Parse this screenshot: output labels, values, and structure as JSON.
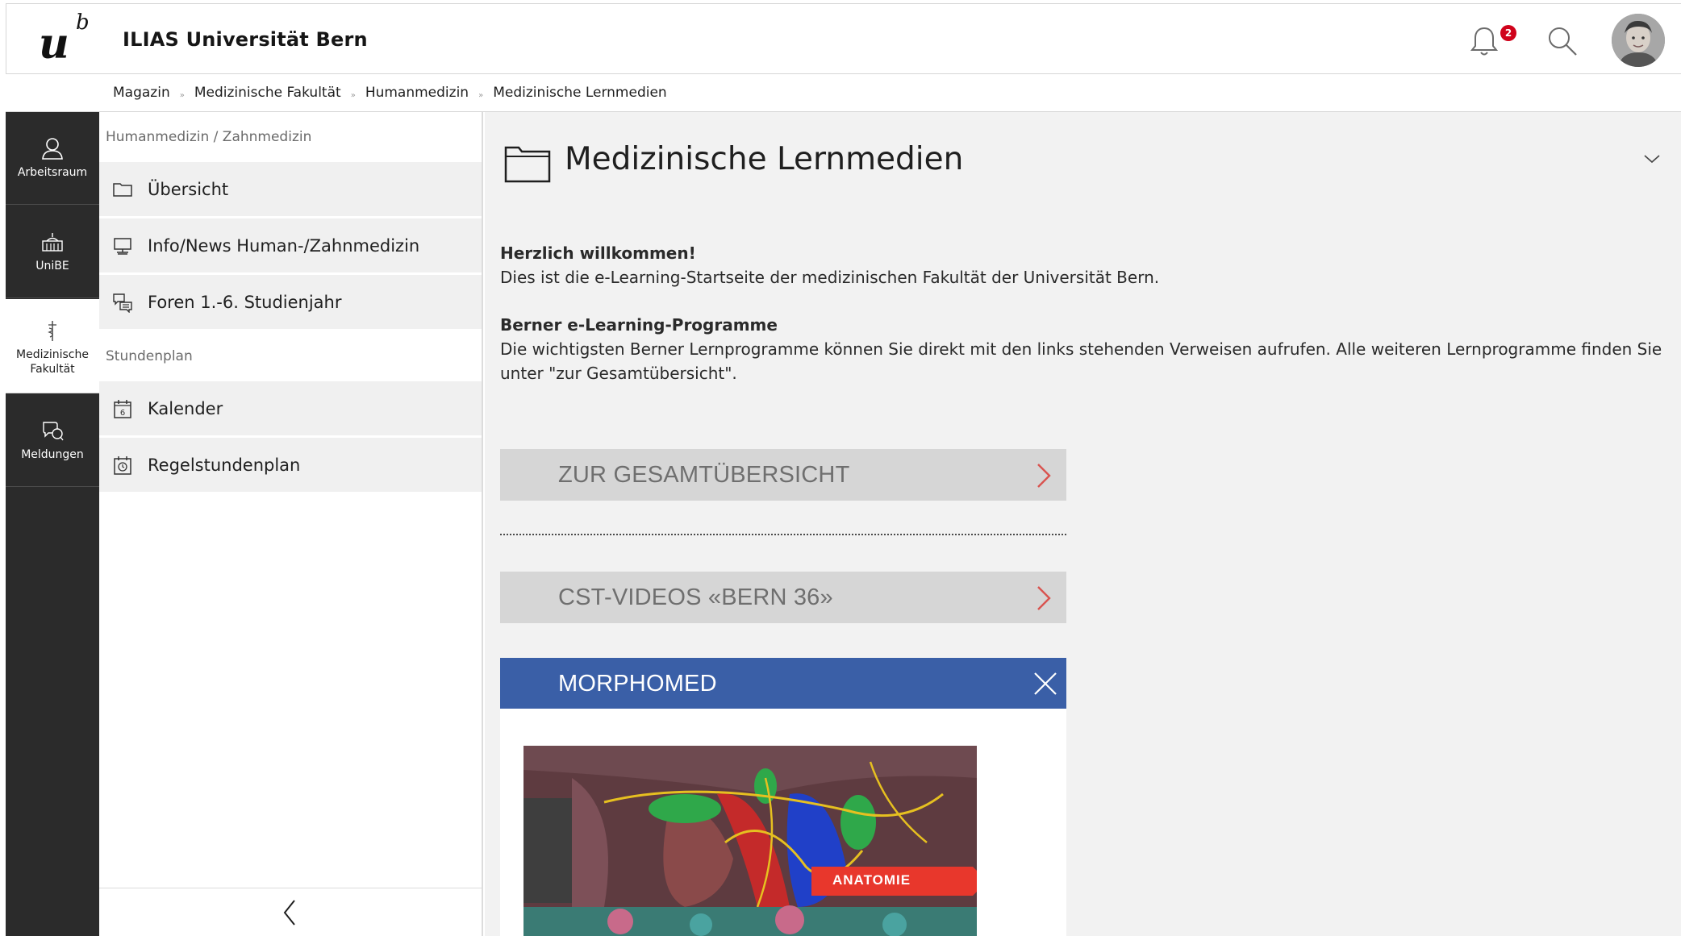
{
  "header": {
    "logo": {
      "letter": "u",
      "superscript": "b"
    },
    "site_title": "ILIAS Universität Bern",
    "notification_count": "2"
  },
  "breadcrumbs": [
    "Magazin",
    "Medizinische Fakultät",
    "Humanmedizin",
    "Medizinische Lernmedien"
  ],
  "breadcrumb_separator": "»",
  "mainbar": {
    "items": [
      {
        "label": "Arbeitsraum",
        "icon": "user-icon"
      },
      {
        "label": "UniBE",
        "icon": "building-icon"
      },
      {
        "label": "Medizinische Fakultät",
        "icon": "caduceus-icon"
      },
      {
        "label": "Meldungen",
        "icon": "chat-icon"
      }
    ]
  },
  "slate": {
    "section1_title": "Humanmedizin / Zahnmedizin",
    "section1_items": [
      {
        "label": "Übersicht",
        "icon": "folder-icon"
      },
      {
        "label": "Info/News Human-/Zahnmedizin",
        "icon": "board-icon"
      },
      {
        "label": "Foren 1.-6. Studienjahr",
        "icon": "forum-icon"
      }
    ],
    "section2_title": "Stundenplan",
    "section2_items": [
      {
        "label": "Kalender",
        "icon": "calendar-icon",
        "calendar_day": "6"
      },
      {
        "label": "Regelstundenplan",
        "icon": "schedule-icon"
      }
    ]
  },
  "content": {
    "title": "Medizinische Lernmedien",
    "welcome_heading": "Herzlich willkommen!",
    "welcome_text": "Dies ist die e-Learning-Startseite der medizinischen Fakultät der Universität Bern.",
    "programs_heading": "Berner e-Learning-Programme",
    "programs_text": "Die wichtigsten Berner Lernprogramme können Sie direkt mit den links stehenden Verweisen aufrufen. Alle weiteren Lernprogramme finden Sie unter \"zur Gesamtübersicht\".",
    "accordions": [
      {
        "label": "ZUR GESAMTÜBERSICHT",
        "state": "collapsed"
      },
      {
        "label": "CST-VIDEOS «BERN 36»",
        "state": "collapsed"
      },
      {
        "label": "MORPHOMED",
        "state": "expanded"
      }
    ],
    "morphomed_tag": "ANATOMIE"
  },
  "colors": {
    "mainbar_bg": "#2b2b2b",
    "accordion_open": "#3a5fa7",
    "accordion_closed": "#d6d6d6",
    "arrow_red": "#d9534f",
    "badge_red": "#d0021b",
    "tag_red": "#e8372c"
  }
}
